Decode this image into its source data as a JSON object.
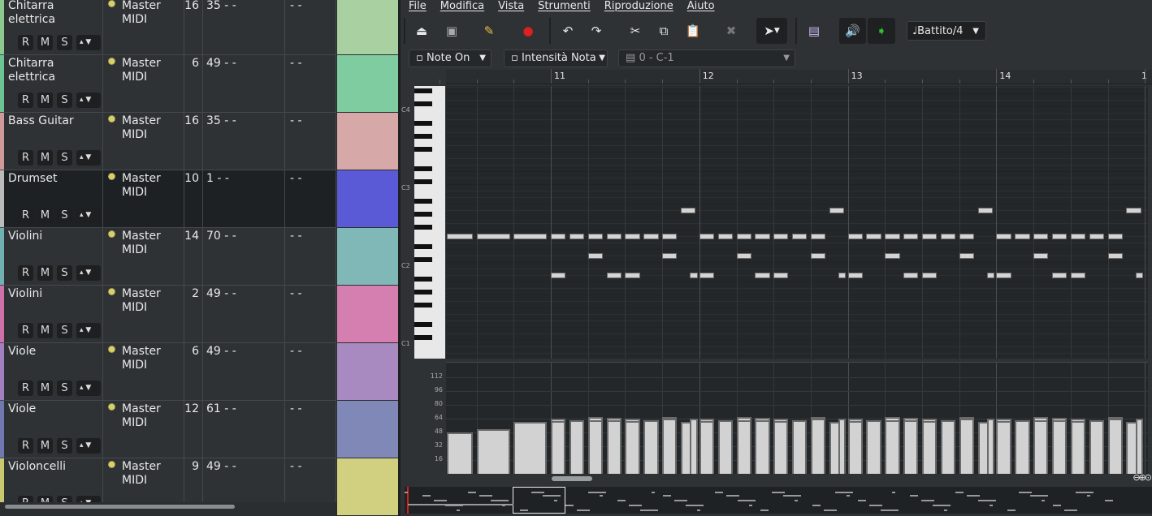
{
  "tracks": [
    {
      "name": "Chitarra elettrica",
      "output": "Master MIDI",
      "channel": "16",
      "program": "35 - -",
      "next": "- -",
      "strip": "#8fc88f",
      "clip": "#a8d0a0",
      "selected": false
    },
    {
      "name": "Chitarra elettrica",
      "output": "Master MIDI",
      "channel": "6",
      "program": "49 - -",
      "next": "- -",
      "strip": "#6cc495",
      "clip": "#7fcca0",
      "selected": false
    },
    {
      "name": "Bass Guitar",
      "output": "Master MIDI",
      "channel": "16",
      "program": "35 - -",
      "next": "- -",
      "strip": "#d09a9a",
      "clip": "#d6a8a8",
      "selected": false
    },
    {
      "name": "Drumset",
      "output": "Master MIDI",
      "channel": "10",
      "program": "1 - -",
      "next": "- -",
      "strip": "#bbbbbb",
      "clip": "#5a5ad6",
      "selected": true
    },
    {
      "name": "Violini",
      "output": "Master MIDI",
      "channel": "14",
      "program": "70 - -",
      "next": "- -",
      "strip": "#70b0b0",
      "clip": "#80b8b8",
      "selected": false
    },
    {
      "name": "Violini",
      "output": "Master MIDI",
      "channel": "2",
      "program": "49 - -",
      "next": "- -",
      "strip": "#d070a8",
      "clip": "#d47fb0",
      "selected": false
    },
    {
      "name": "Viole",
      "output": "Master MIDI",
      "channel": "6",
      "program": "49 - -",
      "next": "- -",
      "strip": "#a080c0",
      "clip": "#a88ac0",
      "selected": false
    },
    {
      "name": "Viole",
      "output": "Master MIDI",
      "channel": "12",
      "program": "61 - -",
      "next": "- -",
      "strip": "#7078b0",
      "clip": "#8088b8",
      "selected": false
    },
    {
      "name": "Violoncelli",
      "output": "Master MIDI",
      "channel": "9",
      "program": "49 - -",
      "next": "- -",
      "strip": "#c8c870",
      "clip": "#d0d080",
      "selected": false
    }
  ],
  "track_buttons": {
    "record": "R",
    "mute": "M",
    "solo": "S",
    "more": "▴"
  },
  "menu": [
    "File",
    "Modifica",
    "Vista",
    "Strumenti",
    "Riproduzione",
    "Aiuto"
  ],
  "toolbar": {
    "snap": "♩Battito/4"
  },
  "filters": {
    "event_type": "Note On",
    "controller": "Intensità Nota",
    "instrument": "0 - C-1"
  },
  "ruler": {
    "bars": [
      "11",
      "12",
      "13",
      "14",
      "1"
    ]
  },
  "piano_labels": [
    "C4",
    "C3",
    "C2",
    "C1"
  ],
  "velocity_labels": [
    "112",
    "96",
    "80",
    "64",
    "48",
    "32",
    "16"
  ],
  "notes": {
    "pre": [
      [
        37.2,
        0.7,
        53,
        48
      ],
      [
        38.0,
        0.9,
        53,
        52
      ],
      [
        39.0,
        0.9,
        53,
        60
      ]
    ],
    "bars": [
      11,
      12,
      13,
      14
    ],
    "pattern": [
      [
        0,
        0.4,
        53,
        64
      ],
      [
        0,
        0.4,
        47,
        61
      ],
      [
        0.5,
        0.4,
        53,
        62
      ],
      [
        1,
        0.4,
        53,
        66
      ],
      [
        1,
        0.4,
        50,
        62
      ],
      [
        1.5,
        0.4,
        53,
        65
      ],
      [
        1.5,
        0.4,
        47,
        62
      ],
      [
        2,
        0.4,
        53,
        64
      ],
      [
        2,
        0.4,
        47,
        61
      ],
      [
        2.5,
        0.4,
        53,
        62
      ],
      [
        3,
        0.4,
        53,
        66
      ],
      [
        3,
        0.4,
        50,
        64
      ],
      [
        3.5,
        0.4,
        57,
        60
      ],
      [
        3.75,
        0.2,
        47,
        64
      ]
    ]
  },
  "colors": {
    "accent": "#d4d4d4",
    "playhead": "#d02020"
  }
}
